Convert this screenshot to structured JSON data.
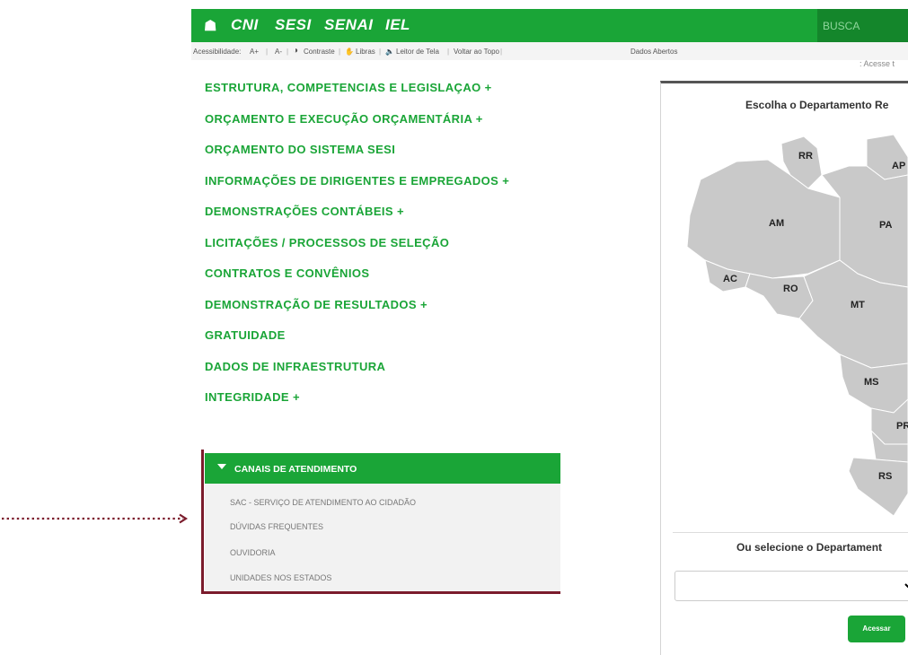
{
  "topbar": {
    "home_icon": "home-icon",
    "brands": [
      "CNI",
      "SESI",
      "SENAI",
      "IEL"
    ],
    "search_placeholder": "BUSCA"
  },
  "accessibility_bar": {
    "label": "Acessibilidade:",
    "font_increase": "A+",
    "font_decrease": "A-",
    "contrast": "Contraste",
    "libras": "Libras",
    "screen_reader": "Leitor de Tela",
    "back_to_top": "Voltar ao Topo",
    "open_data": "Dados Abertos"
  },
  "acesse_text": ": Acesse t",
  "menu": {
    "items": [
      "ESTRUTURA, COMPETENCIAS E LEGISLAÇAO +",
      "ORÇAMENTO E EXECUÇÃO ORÇAMENTÁRIA +",
      "ORÇAMENTO DO SISTEMA SESI",
      "INFORMAÇÕES DE DIRIGENTES E EMPREGADOS +",
      "DEMONSTRAÇÕES CONTÁBEIS +",
      "LICITAÇÕES / PROCESSOS DE SELEÇÃO",
      "CONTRATOS E CONVÊNIOS",
      "DEMONSTRAÇÃO DE RESULTADOS +",
      "GRATUIDADE",
      "DADOS DE INFRAESTRUTURA",
      "INTEGRIDADE +"
    ]
  },
  "canais": {
    "title": "CANAIS DE ATENDIMENTO",
    "links": [
      "SAC - SERVIÇO DE ATENDIMENTO AO CIDADÃO",
      "DÚVIDAS FREQUENTES",
      "OUVIDORIA",
      "UNIDADES NOS ESTADOS"
    ]
  },
  "panel": {
    "title": "Escolha o Departamento Re",
    "select_title": "Ou selecione o Departament",
    "button_label": "Acessar"
  },
  "map": {
    "states": [
      "RR",
      "AP",
      "AM",
      "PA",
      "AC",
      "RO",
      "MT",
      "MS",
      "PR",
      "RS"
    ]
  },
  "colors": {
    "brand_green": "#1aa537",
    "annotation": "#7b1c2c"
  }
}
